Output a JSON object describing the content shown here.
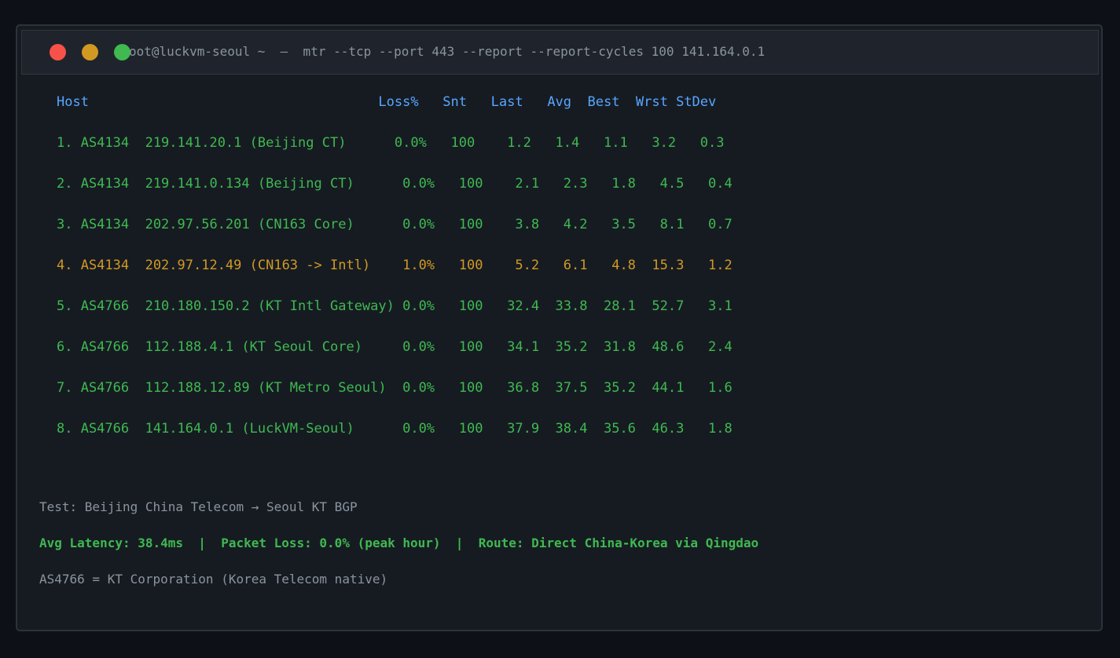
{
  "window": {
    "title": "oot@luckvm-seoul ~  —  mtr --tcp --port 443 --report --report-cycles 100 141.164.0.1",
    "controls": [
      "close",
      "minimize",
      "maximize"
    ],
    "colors": {
      "background": "#0d1117",
      "terminal_bg": "#161b22",
      "titlebar_bg": "#1f242c",
      "header_text": "#58a6ff",
      "ok_text": "#3fb950",
      "warn_text": "#d29922",
      "muted_text": "#8b949e",
      "close_dot": "#f85149",
      "minimize_dot": "#d29922",
      "maximize_dot": "#3fb950"
    }
  },
  "report": {
    "header": "Host                                    Loss%   Snt   Last   Avg  Best  Wrst StDev",
    "hops": [
      {
        "line": "1. AS4134  219.141.20.1 (Beijing CT)      0.0%   100    1.2   1.4   1.1   3.2   0.3",
        "status": "ok"
      },
      {
        "line": "2. AS4134  219.141.0.134 (Beijing CT)      0.0%   100    2.1   2.3   1.8   4.5   0.4",
        "status": "ok"
      },
      {
        "line": "3. AS4134  202.97.56.201 (CN163 Core)      0.0%   100    3.8   4.2   3.5   8.1   0.7",
        "status": "ok"
      },
      {
        "line": "4. AS4134  202.97.12.49 (CN163 -> Intl)    1.0%   100    5.2   6.1   4.8  15.3   1.2",
        "status": "warn"
      },
      {
        "line": "5. AS4766  210.180.150.2 (KT Intl Gateway) 0.0%   100   32.4  33.8  28.1  52.7   3.1",
        "status": "ok"
      },
      {
        "line": "6. AS4766  112.188.4.1 (KT Seoul Core)     0.0%   100   34.1  35.2  31.8  48.6   2.4",
        "status": "ok"
      },
      {
        "line": "7. AS4766  112.188.12.89 (KT Metro Seoul)  0.0%   100   36.8  37.5  35.2  44.1   1.6",
        "status": "ok"
      },
      {
        "line": "8. AS4766  141.164.0.1 (LuckVM-Seoul)      0.0%   100   37.9  38.4  35.6  46.3   1.8",
        "status": "ok"
      }
    ]
  },
  "footer": {
    "test": "Test: Beijing China Telecom → Seoul KT BGP",
    "summary": "Avg Latency: 38.4ms  |  Packet Loss: 0.0% (peak hour)  |  Route: Direct China-Korea via Qingdao",
    "note": "AS4766 = KT Corporation (Korea Telecom native)"
  }
}
